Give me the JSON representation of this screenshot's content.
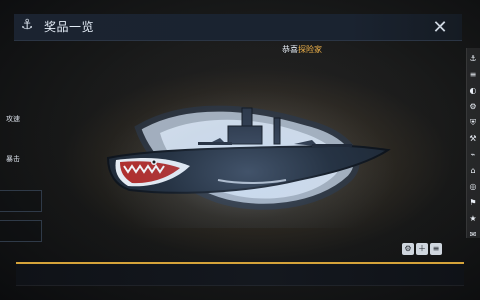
{
  "window": {
    "title": "奖品一览",
    "close_label": "✕"
  },
  "main": {
    "congrats_prefix": "恭喜",
    "congrats_highlight": "探险家"
  },
  "left_panel": {
    "labels": [
      "攻速",
      "暴击"
    ]
  },
  "colors": {
    "accent_gold": "#d5a33a",
    "congrats_highlight": "#f2b44b",
    "panel_blue": "#1b2330"
  },
  "icons": {
    "title": "anchor-icon",
    "close": "close-icon",
    "right_column": [
      "anchor-icon",
      "list-icon",
      "circle-icon",
      "gear-icon",
      "shield-icon",
      "wrench-icon",
      "tag-icon",
      "map-icon",
      "target-icon",
      "flag-icon",
      "star-icon",
      "chat-icon"
    ],
    "bottom": [
      "settings-icon",
      "add-icon",
      "menu-icon"
    ]
  }
}
